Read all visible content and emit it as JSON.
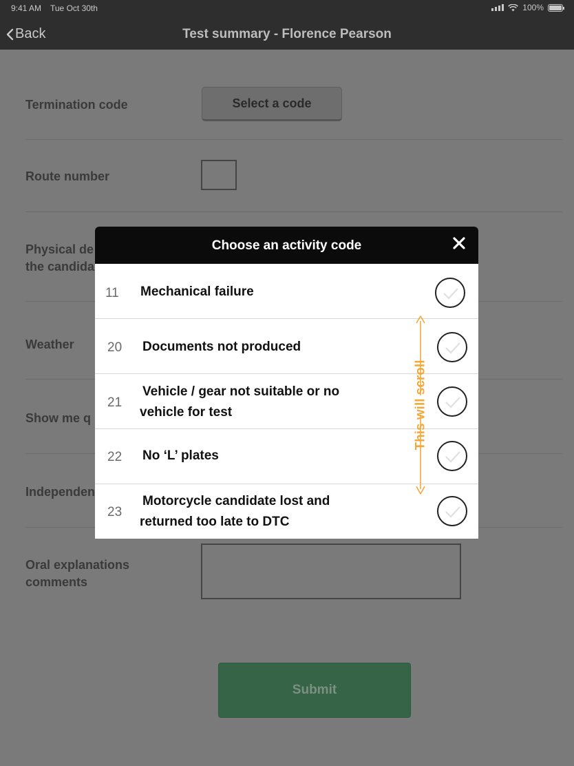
{
  "status_bar": {
    "time": "9:41 AM",
    "date": "Tue Oct 30th",
    "battery": "100%"
  },
  "nav": {
    "back_label": "Back",
    "title": "Test summary - Florence Pearson"
  },
  "form": {
    "termination_label": "Termination code",
    "select_code_label": "Select a code",
    "route_label": "Route number",
    "physical_label_line1": "Physical de",
    "physical_label_line2": "the candida",
    "weather_label": "Weather",
    "show_me_label": "Show me q",
    "independent_label": "Independen",
    "oral_label_line1": "Oral explanations",
    "oral_label_line2": "comments",
    "submit_label": "Submit"
  },
  "modal": {
    "title": "Choose an activity code",
    "codes": [
      {
        "code": "11",
        "line1": "Mechanical failure",
        "line2": ""
      },
      {
        "code": "20",
        "line1": "Documents not produced",
        "line2": ""
      },
      {
        "code": "21",
        "line1": "Vehicle / gear not suitable or no",
        "line2": "vehicle for test"
      },
      {
        "code": "22",
        "line1": "No ‘L’ plates",
        "line2": ""
      },
      {
        "code": "23",
        "line1": "Motorcycle candidate lost and",
        "line2": "returned too late to DTC"
      }
    ]
  },
  "annotation": {
    "scroll_note": "This will scroll",
    "color": "#f2a93b"
  },
  "colors": {
    "overlay_bg": "#7a7a7a",
    "header_bg": "#0b0b0b",
    "submit_bg": "#356447"
  }
}
